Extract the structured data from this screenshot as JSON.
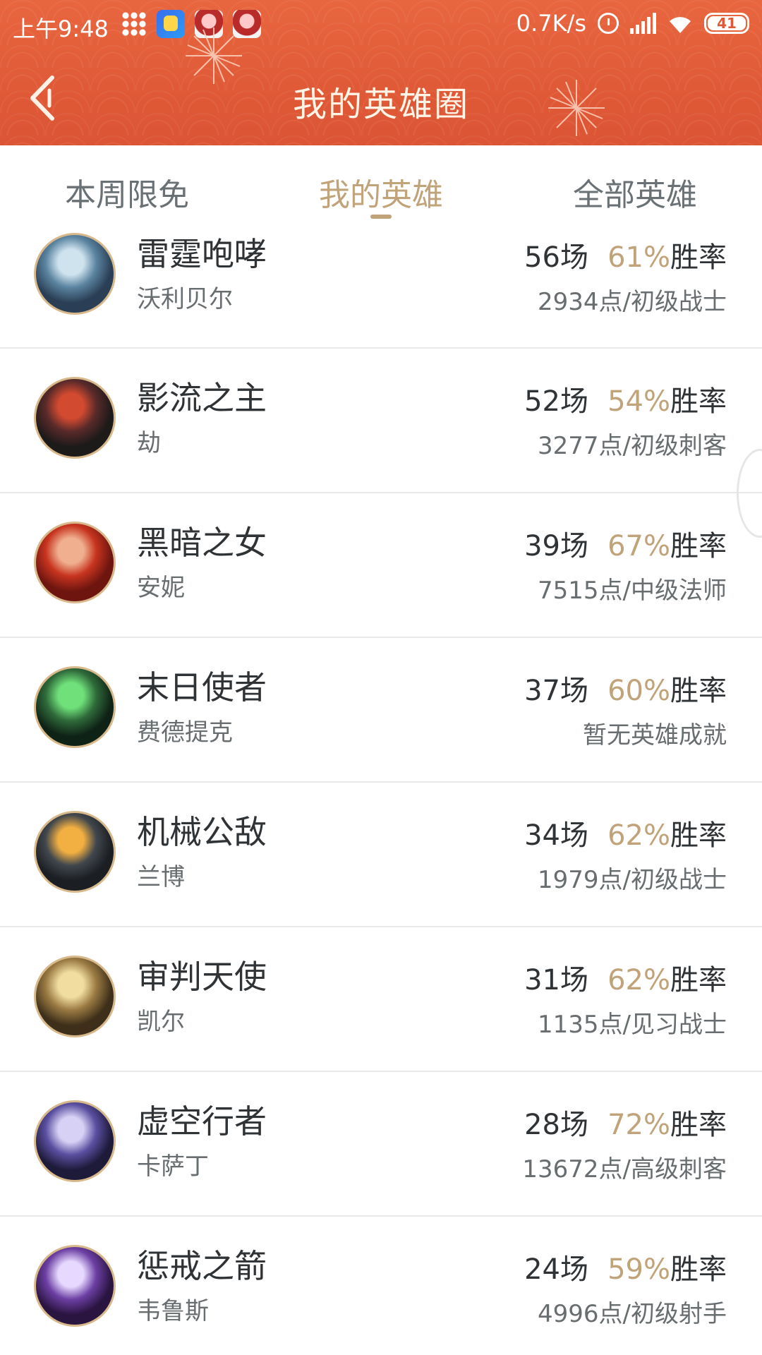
{
  "statusbar": {
    "time": "上午9:48",
    "net_speed": "0.7K/s",
    "battery": "41"
  },
  "header": {
    "title": "我的英雄圈"
  },
  "tabs": [
    {
      "label": "本周限免",
      "active": false
    },
    {
      "label": "我的英雄",
      "active": true
    },
    {
      "label": "全部英雄",
      "active": false
    }
  ],
  "heroes": [
    {
      "title": "雷霆咆哮",
      "name": "沃利贝尔",
      "games": "56场",
      "pct": "61%",
      "pct_suffix": "胜率",
      "rank": "2934点/初级战士",
      "avatar_colors": [
        "#cfe3ef",
        "#5b84a0",
        "#2a3f55"
      ]
    },
    {
      "title": "影流之主",
      "name": "劫",
      "games": "52场",
      "pct": "54%",
      "pct_suffix": "胜率",
      "rank": "3277点/初级刺客",
      "avatar_colors": [
        "#d24a30",
        "#5a2a2a",
        "#1d1a1a"
      ]
    },
    {
      "title": "黑暗之女",
      "name": "安妮",
      "games": "39场",
      "pct": "67%",
      "pct_suffix": "胜率",
      "rank": "7515点/中级法师",
      "avatar_colors": [
        "#f0b090",
        "#c7341f",
        "#6e1510"
      ]
    },
    {
      "title": "末日使者",
      "name": "费德提克",
      "games": "37场",
      "pct": "60%",
      "pct_suffix": "胜率",
      "rank": "暂无英雄成就",
      "avatar_colors": [
        "#6fe07a",
        "#2f6a3a",
        "#0f2216"
      ]
    },
    {
      "title": "机械公敌",
      "name": "兰博",
      "games": "34场",
      "pct": "62%",
      "pct_suffix": "胜率",
      "rank": "1979点/初级战士",
      "avatar_colors": [
        "#f3b042",
        "#41474d",
        "#1b1e22"
      ]
    },
    {
      "title": "审判天使",
      "name": "凯尔",
      "games": "31场",
      "pct": "62%",
      "pct_suffix": "胜率",
      "rank": "1135点/见习战士",
      "avatar_colors": [
        "#f1dda0",
        "#9a7a42",
        "#3e2f1a"
      ]
    },
    {
      "title": "虚空行者",
      "name": "卡萨丁",
      "games": "28场",
      "pct": "72%",
      "pct_suffix": "胜率",
      "rank": "13672点/高级刺客",
      "avatar_colors": [
        "#d7d1f5",
        "#5a4fa0",
        "#1e1a3a"
      ]
    },
    {
      "title": "惩戒之箭",
      "name": "韦鲁斯",
      "games": "24场",
      "pct": "59%",
      "pct_suffix": "胜率",
      "rank": "4996点/初级射手",
      "avatar_colors": [
        "#e6d8ff",
        "#6c3fa3",
        "#2a1440"
      ]
    }
  ]
}
